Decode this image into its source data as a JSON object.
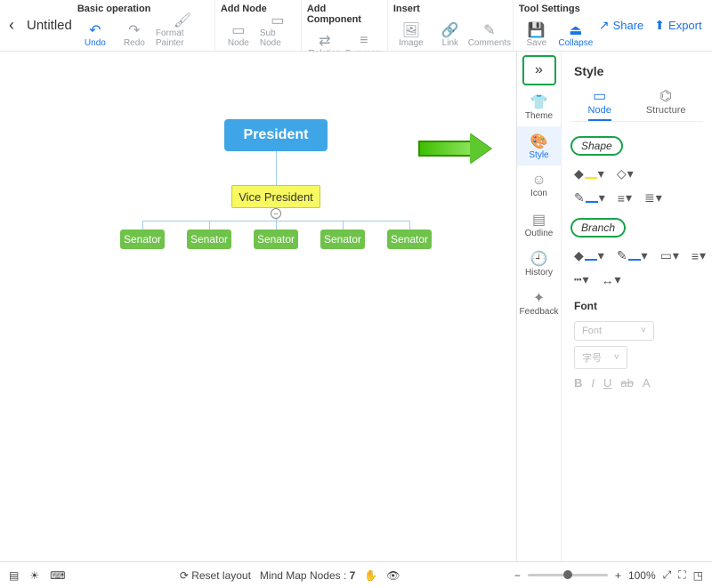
{
  "header": {
    "doc_title": "Untitled",
    "groups": {
      "basic": {
        "title": "Basic operation",
        "undo": "Undo",
        "redo": "Redo",
        "format_painter": "Format Painter"
      },
      "add_node": {
        "title": "Add Node",
        "node": "Node",
        "sub_node": "Sub Node"
      },
      "add_component": {
        "title": "Add Component",
        "relation": "Relation",
        "summary": "Summary"
      },
      "insert": {
        "title": "Insert",
        "image": "Image",
        "link": "Link",
        "comments": "Comments"
      },
      "tool_settings": {
        "title": "Tool Settings",
        "save": "Save",
        "collapse": "Collapse"
      }
    },
    "share": "Share",
    "export": "Export"
  },
  "mindmap": {
    "president": "President",
    "vp": "Vice President",
    "senators": [
      "Senator",
      "Senator",
      "Senator",
      "Senator",
      "Senator"
    ]
  },
  "right_panel": {
    "title": "Style",
    "sidebar": {
      "theme": "Theme",
      "style": "Style",
      "icon": "Icon",
      "outline": "Outline",
      "history": "History",
      "feedback": "Feedback"
    },
    "tabs": {
      "node": "Node",
      "structure": "Structure"
    },
    "sections": {
      "shape": "Shape",
      "branch": "Branch",
      "font": "Font"
    },
    "font_select": "Font",
    "size_select": "字号"
  },
  "statusbar": {
    "reset_layout": "Reset layout",
    "nodes_label": "Mind Map Nodes :",
    "node_count": "7",
    "zoom": "100%"
  }
}
